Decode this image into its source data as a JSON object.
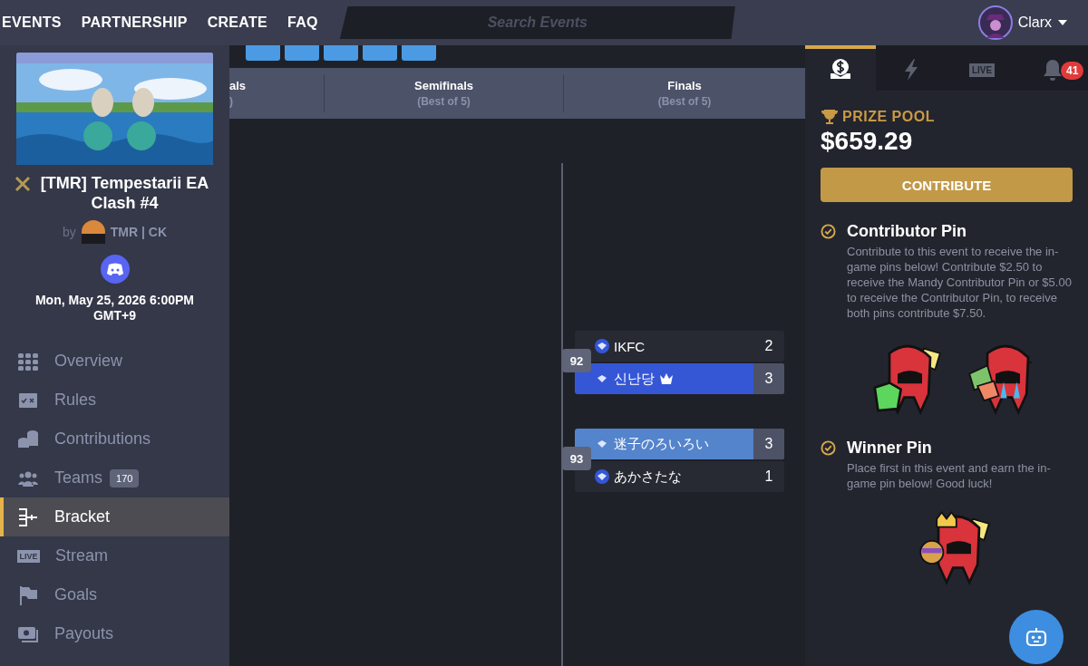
{
  "top_nav": {
    "links": [
      "EVENTS",
      "PARTNERSHIP",
      "CREATE",
      "FAQ"
    ],
    "search": {
      "placeholder": "Search Events"
    },
    "user": {
      "name": "Clarx"
    }
  },
  "event": {
    "title": "[TMR] Tempestarii EA Clash #4",
    "by": "by",
    "organizer": "TMR | CK",
    "date": "Mon, May 25, 2026 6:00PM GMT+9"
  },
  "sidebar": {
    "items": [
      {
        "kind": "grid",
        "label": "Overview",
        "selected": false
      },
      {
        "kind": "book",
        "label": "Rules",
        "selected": false
      },
      {
        "kind": "coins",
        "label": "Contributions",
        "selected": false
      },
      {
        "kind": "people",
        "label": "Teams",
        "badge": "170",
        "selected": false
      },
      {
        "kind": "bracket",
        "label": "Bracket",
        "selected": true
      },
      {
        "kind": "live",
        "label": "Stream",
        "icon_text": "LIVE",
        "selected": false
      },
      {
        "kind": "flag",
        "label": "Goals",
        "selected": false
      },
      {
        "kind": "money",
        "label": "Payouts",
        "selected": false
      }
    ]
  },
  "bracket": {
    "rounds": [
      {
        "title": "als",
        "subtitle": ")"
      },
      {
        "title": "Semifinals",
        "subtitle": "(Best of 5)"
      },
      {
        "title": "Finals",
        "subtitle": "(Best of 5)"
      }
    ],
    "matches": [
      {
        "number": "92",
        "teams": [
          {
            "name": "IKFC",
            "score": "2",
            "winner": false,
            "crown": false
          },
          {
            "name": "신난당",
            "score": "3",
            "winner": true,
            "crown": true,
            "color": "#3557d6"
          }
        ]
      },
      {
        "number": "93",
        "teams": [
          {
            "name": "迷子のろいろい",
            "score": "3",
            "winner": true,
            "crown": false,
            "color": "#5484cc"
          },
          {
            "name": "あかさたな",
            "score": "1",
            "winner": false,
            "crown": false
          }
        ]
      }
    ]
  },
  "right_panel": {
    "tabs": [
      {
        "kind": "prize",
        "selected": true
      },
      {
        "kind": "bolt",
        "selected": false
      },
      {
        "kind": "live",
        "icon_text": "LIVE",
        "selected": false
      },
      {
        "kind": "bell",
        "badge": "41",
        "selected": false
      }
    ],
    "prize_pool": {
      "label": "PRIZE POOL",
      "amount": "$659.29"
    },
    "contribute_button": "CONTRIBUTE",
    "pins": [
      {
        "title": "Contributor Pin",
        "text": "Contribute to this event to receive the in-game pins below! Contribute $2.50 to receive the Mandy Contributor Pin or $5.00 to receive the Contributor Pin, to receive both pins contribute $7.50."
      },
      {
        "title": "Winner Pin",
        "text": "Place first in this event and earn the in-game pin below! Good luck!"
      }
    ]
  }
}
